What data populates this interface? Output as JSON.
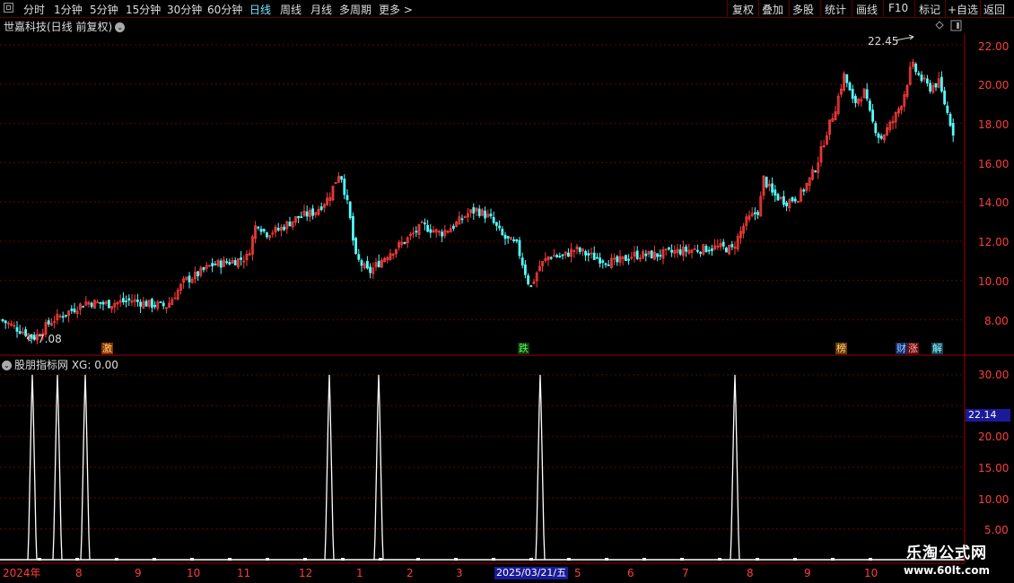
{
  "toolbar": {
    "periods": [
      "分时",
      "1分钟",
      "5分钟",
      "15分钟",
      "30分钟",
      "60分钟",
      "日线",
      "周线",
      "月线",
      "多周期",
      "更多 >"
    ],
    "active_period": "日线",
    "actions": [
      "复权",
      "叠加",
      "多股",
      "统计",
      "画线",
      "F10",
      "标记",
      "+自选",
      "返回"
    ]
  },
  "main_panel": {
    "title": "世嘉科技(日线 前复权)",
    "y_ticks": [
      "22.00",
      "20.00",
      "18.00",
      "16.00",
      "14.00",
      "12.00",
      "10.00",
      "8.00"
    ],
    "high_label": "22.45",
    "low_label": "7.08",
    "event_tags": [
      "激",
      "跌",
      "榜",
      "财",
      "涨",
      "解"
    ]
  },
  "sub_panel": {
    "title": "股朋指标网 XG: 0.00",
    "y_ticks": [
      "30.00",
      "25.00",
      "20.00",
      "15.00",
      "10.00",
      "5.00"
    ],
    "current_price": "22.14"
  },
  "x_axis": {
    "labels": [
      "2024年",
      "8",
      "9",
      "10",
      "11",
      "12",
      "1",
      "2",
      "3",
      "2025/03/21/五",
      "5",
      "6",
      "7",
      "8",
      "9",
      "10"
    ]
  },
  "watermark": {
    "line1": "乐淘公式网",
    "line2": "www.60lt.com"
  },
  "chart_data": [
    {
      "type": "candlestick",
      "title": "世嘉科技(日线 前复权)",
      "ylim": [
        6.5,
        22.6
      ],
      "up_color": "#ff3c3c",
      "down_color": "#54ffff",
      "annotations": [
        {
          "text": "22.45",
          "kind": "high"
        },
        {
          "text": "7.08",
          "kind": "low"
        }
      ],
      "close_path": [
        [
          0,
          8.0
        ],
        [
          25,
          7.4
        ],
        [
          38,
          7.1
        ],
        [
          55,
          7.9
        ],
        [
          75,
          8.4
        ],
        [
          95,
          8.9
        ],
        [
          120,
          8.8
        ],
        [
          145,
          9.0
        ],
        [
          165,
          8.8
        ],
        [
          185,
          8.7
        ],
        [
          205,
          10.0
        ],
        [
          215,
          10.2
        ],
        [
          235,
          10.8
        ],
        [
          260,
          11.0
        ],
        [
          275,
          11.2
        ],
        [
          285,
          13.0
        ],
        [
          295,
          12.4
        ],
        [
          310,
          12.6
        ],
        [
          330,
          13.2
        ],
        [
          350,
          13.5
        ],
        [
          365,
          14.2
        ],
        [
          378,
          15.6
        ],
        [
          388,
          13.5
        ],
        [
          395,
          11.2
        ],
        [
          410,
          10.4
        ],
        [
          430,
          11.3
        ],
        [
          450,
          12.0
        ],
        [
          470,
          12.8
        ],
        [
          490,
          12.4
        ],
        [
          505,
          12.8
        ],
        [
          520,
          13.4
        ],
        [
          530,
          13.6
        ],
        [
          545,
          13.2
        ],
        [
          560,
          12.2
        ],
        [
          575,
          11.8
        ],
        [
          590,
          9.6
        ],
        [
          600,
          10.7
        ],
        [
          612,
          11.3
        ],
        [
          625,
          11.2
        ],
        [
          640,
          11.6
        ],
        [
          660,
          11.2
        ],
        [
          685,
          10.9
        ],
        [
          705,
          11.3
        ],
        [
          730,
          11.3
        ],
        [
          755,
          11.5
        ],
        [
          780,
          11.6
        ],
        [
          800,
          11.7
        ],
        [
          815,
          11.6
        ],
        [
          830,
          13.0
        ],
        [
          845,
          13.6
        ],
        [
          850,
          15.2
        ],
        [
          860,
          14.4
        ],
        [
          875,
          14.0
        ],
        [
          890,
          14.3
        ],
        [
          902,
          15.2
        ],
        [
          910,
          16.0
        ],
        [
          920,
          17.5
        ],
        [
          930,
          18.8
        ],
        [
          940,
          20.5
        ],
        [
          950,
          19.0
        ],
        [
          962,
          19.6
        ],
        [
          970,
          18.2
        ],
        [
          980,
          17.2
        ],
        [
          995,
          18.2
        ],
        [
          1005,
          19.2
        ],
        [
          1015,
          21.0
        ],
        [
          1025,
          20.3
        ],
        [
          1035,
          19.8
        ],
        [
          1045,
          20.1
        ],
        [
          1055,
          18.5
        ],
        [
          1065,
          17.0
        ]
      ]
    },
    {
      "type": "bar",
      "title": "股朋指标网 XG",
      "ylim": [
        0,
        32
      ],
      "color": "#ffffff",
      "spikes_x": [
        36,
        64,
        95,
        367,
        422,
        602,
        819
      ],
      "spike_value": 30,
      "baseline_markers_x": [
        44,
        86,
        130,
        172,
        214,
        256,
        298,
        340,
        382,
        424,
        466,
        508,
        550,
        592,
        634,
        676,
        718,
        760,
        802,
        844,
        886,
        928,
        970
      ]
    }
  ]
}
